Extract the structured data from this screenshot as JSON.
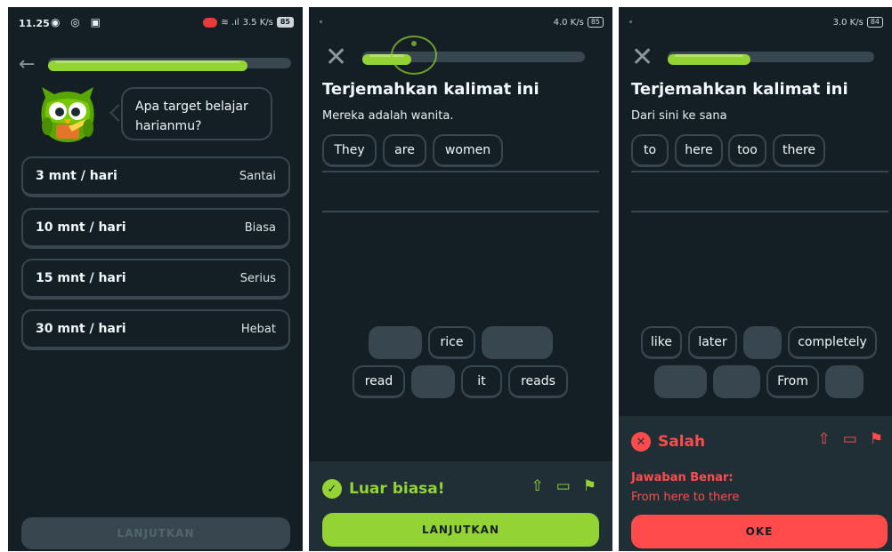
{
  "colors": {
    "background": "#131f24",
    "accent_green": "#93d333",
    "error_red": "#ff4b4b",
    "border": "#37464f",
    "panel": "#202f36"
  },
  "screen1": {
    "status": {
      "time": "11.25",
      "battery": "85",
      "network": "3.5 K/s"
    },
    "progress": 0.82,
    "question": "Apa target belajar harianmu?",
    "goals": [
      {
        "time": "3 mnt / hari",
        "level": "Santai"
      },
      {
        "time": "10 mnt / hari",
        "level": "Biasa"
      },
      {
        "time": "15 mnt / hari",
        "level": "Serius"
      },
      {
        "time": "30 mnt / hari",
        "level": "Hebat"
      }
    ],
    "continue_label": "LANJUTKAN",
    "icons": {
      "back": "back-arrow-icon",
      "mascot": "owl-mascot-icon"
    }
  },
  "screen2": {
    "status": {
      "battery": "85",
      "network": "4.0 K/s"
    },
    "progress": 0.22,
    "title": "Terjemahkan kalimat ini",
    "prompt": "Mereka adalah wanita.",
    "answer_chips": [
      "They",
      "are",
      "women"
    ],
    "word_bank_row1": [
      "",
      "rice",
      ""
    ],
    "word_bank_row2": [
      "read",
      "",
      "it",
      "reads"
    ],
    "feedback": "Luar biasa!",
    "continue_label": "LANJUTKAN"
  },
  "screen3": {
    "status": {
      "battery": "84",
      "network": "3.0 K/s"
    },
    "progress": 0.4,
    "title": "Terjemahkan kalimat ini",
    "prompt": "Dari sini ke sana",
    "answer_chips": [
      "to",
      "here",
      "too",
      "there"
    ],
    "word_bank_row1": [
      "like",
      "later",
      "",
      "completely"
    ],
    "word_bank_row2": [
      "",
      "",
      "From",
      ""
    ],
    "feedback": "Salah",
    "correct_label": "Jawaban Benar:",
    "correct_answer": "From here to there",
    "ok_label": "OKE"
  }
}
